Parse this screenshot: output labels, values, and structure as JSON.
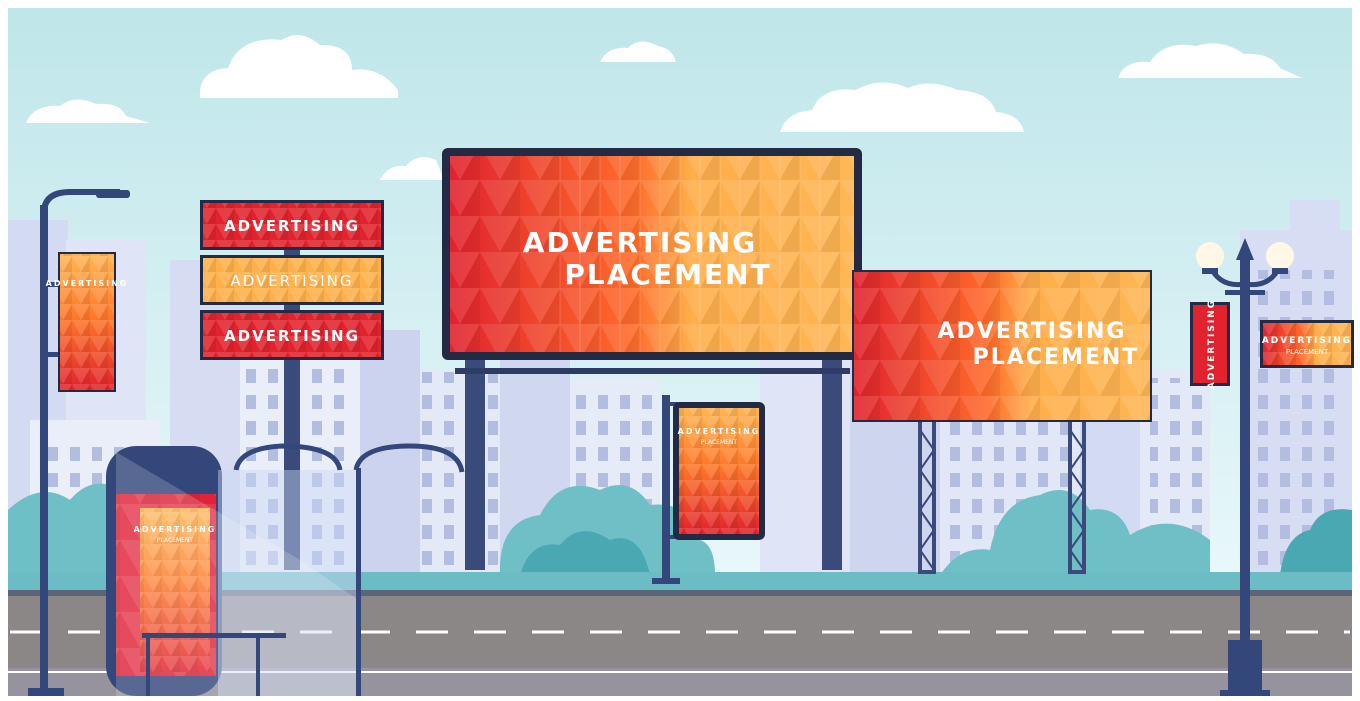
{
  "scene": {
    "colors": {
      "sky_top": "#bfe6ea",
      "sky_bottom": "#e8f7fb",
      "city": "#d6ddf2",
      "city_dark": "#c2cbea",
      "window": "#aab5dc",
      "bush": "#6fbfc7",
      "bush_dark": "#4aa8b3",
      "road": "#8a8585",
      "pole": "#34477a",
      "red": "#e0232e",
      "orange": "#ff8a2a",
      "yellow": "#ffb14a"
    }
  },
  "signs": {
    "main_billboard": {
      "line1": "ADVERTISING",
      "line2": "PLACEMENT"
    },
    "right_billboard": {
      "line1": "ADVERTISING",
      "line2": "PLACEMENT"
    },
    "stack_top": "ADVERTISING",
    "stack_middle": "ADVERTISING",
    "stack_bottom": "ADVERTISING",
    "lamp_banner_left": "ADVERTISING",
    "lamp_banner_right_vertical": "ADVERTISING",
    "lamp_banner_right_horizontal": {
      "line1": "ADVERTISING",
      "line2": "PLACEMENT"
    },
    "small_display": {
      "line1": "ADVERTISING",
      "line2": "PLACEMENT"
    },
    "bus_stop_poster": {
      "line1": "ADVERTISING",
      "line2": "PLACEMENT"
    }
  }
}
